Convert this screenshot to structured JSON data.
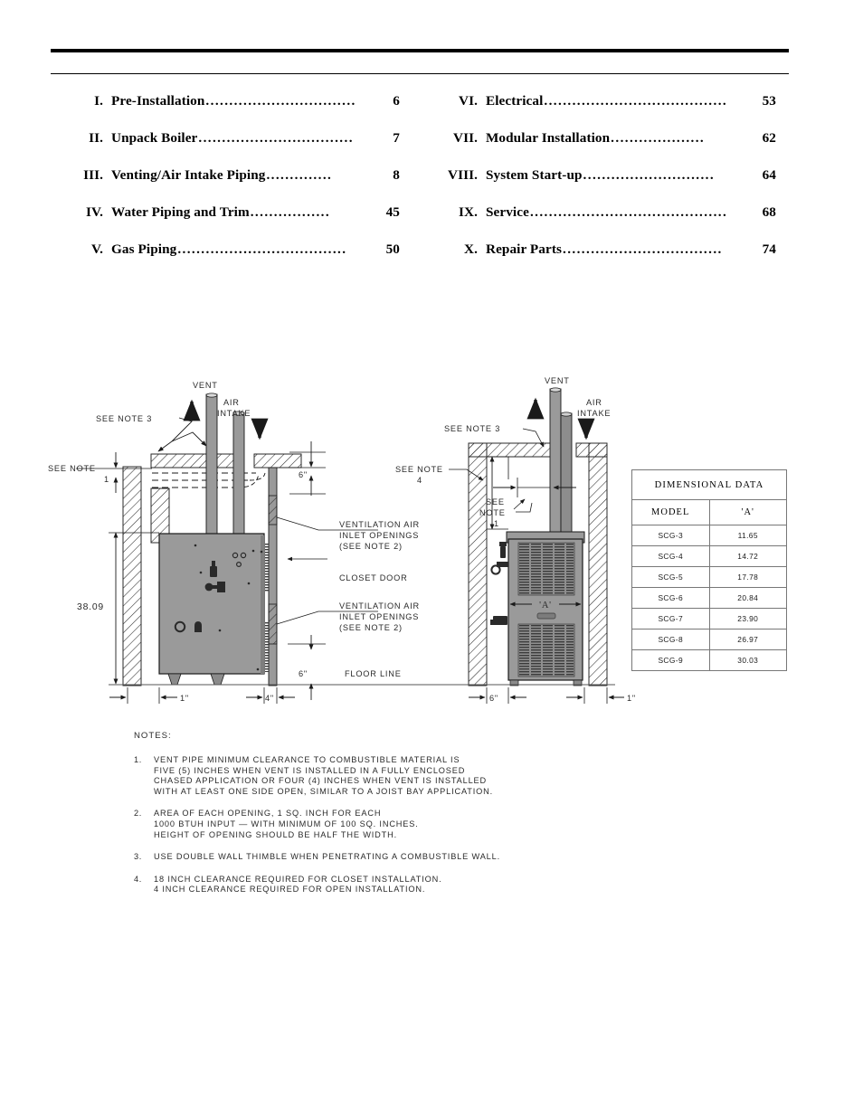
{
  "header": {
    "rule_thick_color": "#000000",
    "rule_thin_color": "#000000"
  },
  "toc": {
    "left_column": [
      {
        "numeral": "I.",
        "title": "Pre-Installation",
        "dots": "................................",
        "page": "6"
      },
      {
        "numeral": "II.",
        "title": "Unpack Boiler",
        "dots": ".................................",
        "page": "7"
      },
      {
        "numeral": "III.",
        "title": "Venting/Air Intake Piping",
        "dots": "..............",
        "page": "8"
      },
      {
        "numeral": "IV.",
        "title": "Water Piping and Trim",
        "dots": ".................",
        "page": "45"
      },
      {
        "numeral": "V.",
        "title": "Gas Piping",
        "dots": "....................................",
        "page": "50"
      }
    ],
    "right_column": [
      {
        "numeral": "VI.",
        "title": "Electrical",
        "dots": ".......................................",
        "page": "53"
      },
      {
        "numeral": "VII.",
        "title": "Modular Installation",
        "dots": "....................",
        "page": "62"
      },
      {
        "numeral": "VIII.",
        "title": "System Start-up",
        "dots": "............................",
        "page": "64"
      },
      {
        "numeral": "IX.",
        "title": "Service",
        "dots": "..........................................",
        "page": "68"
      },
      {
        "numeral": "X.",
        "title": "Repair Parts",
        "dots": "..................................",
        "page": "74"
      }
    ]
  },
  "drawing": {
    "colors": {
      "unit_fill": "#9a9a9a",
      "unit_stroke": "#1a1a1a",
      "line": "#1a1a1a",
      "hatch": "#2a2a2a",
      "text": "#2a2a2a"
    },
    "left_view": {
      "vent_label": "VENT",
      "air_intake_label": "AIR\nINTAKE",
      "air_intake_line1": "AIR",
      "air_intake_line2": "INTAKE",
      "see_note_3": "SEE NOTE 3",
      "see_note_1_line1": "SEE  NOTE",
      "see_note_1_line2": "1",
      "height_dim": "38.09",
      "clearance_wall": "1\"",
      "clearance_door": "4\"",
      "vent_top_clearance": "6\"",
      "vent_bottom_clearance": "6\"",
      "floor_line_label": "FLOOR  LINE",
      "callout_vent_air_top_line1": "VENTILATION AIR",
      "callout_vent_air_top_line2": "INLET OPENINGS",
      "callout_vent_air_top_line3": "(SEE NOTE 2)",
      "callout_closet_door": "CLOSET DOOR",
      "callout_vent_air_bottom_line1": "VENTILATION AIR",
      "callout_vent_air_bottom_line2": "INLET OPENINGS",
      "callout_vent_air_bottom_line3": "(SEE NOTE 2)"
    },
    "right_view": {
      "vent_label": "VENT",
      "air_intake_line1": "AIR",
      "air_intake_line2": "INTAKE",
      "see_note_3": "SEE  NOTE  3",
      "see_note_4_line1": "SEE  NOTE",
      "see_note_4_line2": "4",
      "see_note_1_line1": "SEE",
      "see_note_1_line2": "NOTE",
      "see_note_1_line3": "1",
      "width_dim_label": "'A'",
      "clearance_left": "6\"",
      "clearance_right": "1\""
    }
  },
  "dimensional_table": {
    "title": "DIMENSIONAL  DATA",
    "columns": [
      "MODEL",
      "'A'"
    ],
    "rows": [
      {
        "model": "SCG-3",
        "a": "11.65"
      },
      {
        "model": "SCG-4",
        "a": "14.72"
      },
      {
        "model": "SCG-5",
        "a": "17.78"
      },
      {
        "model": "SCG-6",
        "a": "20.84"
      },
      {
        "model": "SCG-7",
        "a": "23.90"
      },
      {
        "model": "SCG-8",
        "a": "26.97"
      },
      {
        "model": "SCG-9",
        "a": "30.03"
      }
    ]
  },
  "notes": {
    "heading": "NOTES:",
    "items": [
      {
        "index": "1.",
        "lines": [
          "VENT PIPE MINIMUM CLEARANCE TO COMBUSTIBLE MATERIAL IS",
          "FIVE (5) INCHES WHEN VENT IS INSTALLED IN A FULLY ENCLOSED",
          "CHASED APPLICATION OR FOUR (4) INCHES WHEN VENT IS INSTALLED",
          "WITH AT LEAST ONE SIDE OPEN, SIMILAR TO A JOIST BAY APPLICATION."
        ]
      },
      {
        "index": "2.",
        "lines": [
          "AREA OF EACH OPENING, 1 SQ. INCH FOR EACH",
          "1000 BTUH INPUT — WITH MINIMUM OF 100 SQ. INCHES.",
          "HEIGHT OF OPENING SHOULD BE HALF THE WIDTH."
        ]
      },
      {
        "index": "3.",
        "lines": [
          "USE DOUBLE WALL THIMBLE WHEN PENETRATING A COMBUSTIBLE WALL."
        ]
      },
      {
        "index": "4.",
        "lines": [
          "18 INCH CLEARANCE REQUIRED FOR CLOSET INSTALLATION.",
          "4 INCH CLEARANCE REQUIRED FOR OPEN INSTALLATION."
        ]
      }
    ]
  }
}
